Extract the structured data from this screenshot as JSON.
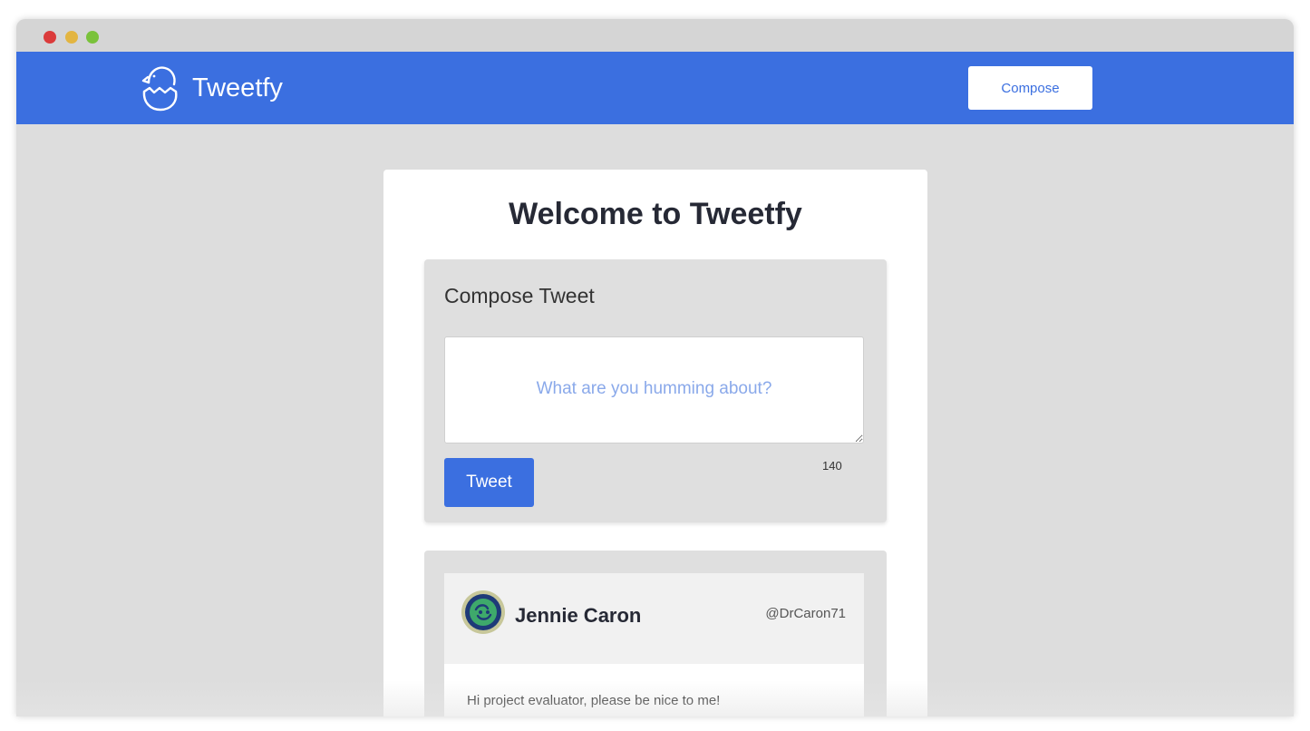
{
  "colors": {
    "brand": "#3b6fe0",
    "page_bg": "#dddddd",
    "title_text": "#262935",
    "placeholder": "#8aa9ea"
  },
  "navbar": {
    "logo_icon": "chick-in-egg-icon",
    "brand_name": "Tweetfy",
    "compose_label": "Compose"
  },
  "main": {
    "title": "Welcome to Tweetfy",
    "compose": {
      "heading": "Compose Tweet",
      "placeholder": "What are you humming about?",
      "tweet_button_label": "Tweet",
      "char_counter": "140"
    },
    "tweets": [
      {
        "avatar_icon": "avatar-icon",
        "name": "Jennie Caron",
        "handle": "@DrCaron71",
        "text": "Hi project evaluator, please be nice to me!"
      }
    ]
  }
}
